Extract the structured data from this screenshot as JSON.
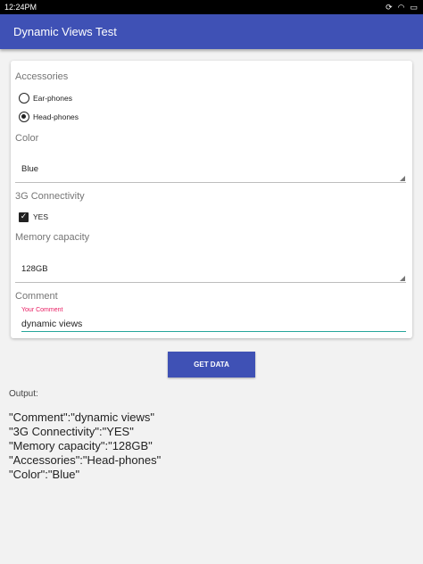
{
  "status_bar": {
    "time": "12:24PM",
    "icons": [
      "sync-icon",
      "wifi-icon",
      "battery-icon"
    ]
  },
  "app_bar": {
    "title": "Dynamic Views Test"
  },
  "form": {
    "accessories": {
      "label": "Accessories",
      "options": [
        {
          "label": "Ear-phones",
          "checked": false
        },
        {
          "label": "Head-phones",
          "checked": true
        }
      ]
    },
    "color": {
      "label": "Color",
      "value": "Blue"
    },
    "connectivity": {
      "label": "3G Connectivity",
      "checkbox_label": "YES",
      "checked": true
    },
    "memory": {
      "label": "Memory capacity",
      "value": "128GB"
    },
    "comment": {
      "label": "Comment",
      "hint": "Your Comment",
      "value": "dynamic views"
    }
  },
  "get_data_label": "GET DATA",
  "output": {
    "label": "Output:",
    "lines": [
      "\"Comment\":\"dynamic views\"",
      "\"3G Connectivity\":\"YES\"",
      "\"Memory capacity\":\"128GB\"",
      "\"Accessories\":\"Head-phones\"",
      "\"Color\":\"Blue\""
    ]
  }
}
